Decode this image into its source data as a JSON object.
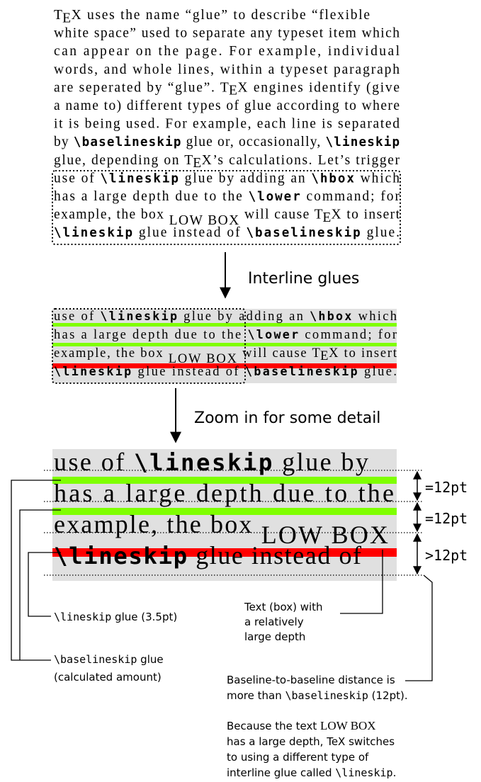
{
  "paragraph": {
    "lines": [
      {
        "parts": [
          {
            "t": "indent"
          },
          {
            "t": "tex"
          },
          {
            "t": "txt",
            "v": " uses the name “glue” to describe “flexible"
          }
        ]
      },
      {
        "parts": [
          {
            "t": "txt",
            "v": "white space” used to separate any typeset item which"
          }
        ]
      },
      {
        "parts": [
          {
            "t": "txt",
            "v": "can appear on the page.  For example, individual"
          }
        ]
      },
      {
        "parts": [
          {
            "t": "txt",
            "v": "words, and whole lines, within a typeset paragraph"
          }
        ]
      },
      {
        "parts": [
          {
            "t": "txt",
            "v": "are seperated by “glue”.  "
          },
          {
            "t": "tex"
          },
          {
            "t": "txt",
            "v": " engines identify (give"
          }
        ]
      },
      {
        "parts": [
          {
            "t": "txt",
            "v": "a name to) different types of glue according to where"
          }
        ]
      },
      {
        "parts": [
          {
            "t": "txt",
            "v": "it is being used. For example, each line is separated"
          }
        ]
      },
      {
        "parts": [
          {
            "t": "txt",
            "v": "by "
          },
          {
            "t": "code",
            "v": "\\baselineskip"
          },
          {
            "t": "txt",
            "v": " glue or, occasionally, "
          },
          {
            "t": "code",
            "v": "\\lineskip"
          }
        ]
      },
      {
        "parts": [
          {
            "t": "txt",
            "v": "glue, depending on "
          },
          {
            "t": "tex"
          },
          {
            "t": "txt",
            "v": "’s calculations. Let’s trigger"
          }
        ]
      },
      {
        "parts": [
          {
            "t": "txt",
            "v": "use of "
          },
          {
            "t": "code",
            "v": "\\lineskip"
          },
          {
            "t": "txt",
            "v": " glue by adding an "
          },
          {
            "t": "code",
            "v": "\\hbox"
          },
          {
            "t": "txt",
            "v": " which"
          }
        ]
      },
      {
        "parts": [
          {
            "t": "txt",
            "v": "has a large depth due to the "
          },
          {
            "t": "code",
            "v": "\\lower"
          },
          {
            "t": "txt",
            "v": " command; for"
          }
        ]
      },
      {
        "parts": [
          {
            "t": "txt",
            "v": "example, the box "
          },
          {
            "t": "low",
            "v": "LOW BOX"
          },
          {
            "t": "txt",
            "v": " will cause "
          },
          {
            "t": "tex"
          },
          {
            "t": "txt",
            "v": " to insert"
          }
        ]
      },
      {
        "parts": [
          {
            "t": "code",
            "v": "\\lineskip"
          },
          {
            "t": "txt",
            "v": " glue instead of "
          },
          {
            "t": "code",
            "v": "\\baselineskip"
          },
          {
            "t": "txt",
            "v": " glue."
          }
        ]
      }
    ]
  },
  "arrow1_label": "Interline glues",
  "arrow2_label": "Zoom in for some detail",
  "zoom_lines": [
    {
      "parts": [
        {
          "t": "txt",
          "v": "use of "
        },
        {
          "t": "code",
          "v": "\\lineskip"
        },
        {
          "t": "txt",
          "v": " glue by"
        }
      ]
    },
    {
      "parts": [
        {
          "t": "txt",
          "v": "has a large depth due to the"
        }
      ]
    },
    {
      "parts": [
        {
          "t": "txt",
          "v": "example, the box "
        },
        {
          "t": "low",
          "v": "LOW BOX"
        }
      ]
    },
    {
      "parts": [
        {
          "t": "code",
          "v": "\\lineskip"
        },
        {
          "t": "txt",
          "v": " glue instead of"
        }
      ]
    }
  ],
  "measures": [
    "=12pt",
    "=12pt",
    ">12pt"
  ],
  "labels": {
    "lineskip_code": "\\lineskip",
    "lineskip_rest": " glue (3.5pt)",
    "baselineskip_code": "\\baselineskip",
    "baselineskip_rest": " glue",
    "baselineskip_line2": "(calculated amount)",
    "depth_box": [
      "Text (box) with",
      "a relatively",
      "large depth"
    ],
    "note1_line1": "Baseline-to-baseline distance is",
    "note1_line2_pre": "more than ",
    "note1_line2_code": "\\baselineskip",
    "note1_line2_post": " (12pt).",
    "note2_line1_pre": "Because the text ",
    "note2_line1_box": "LOW BOX",
    "note2_line2": "has a large depth, TeX switches",
    "note2_line3": "to using a different type of",
    "note2_line4_pre": "interline glue called ",
    "note2_line4_code": "\\lineskip",
    "note2_line4_post": "."
  },
  "colors": {
    "green": "#7fff00",
    "red": "#ff0000",
    "gray": "#e0e0e0"
  }
}
